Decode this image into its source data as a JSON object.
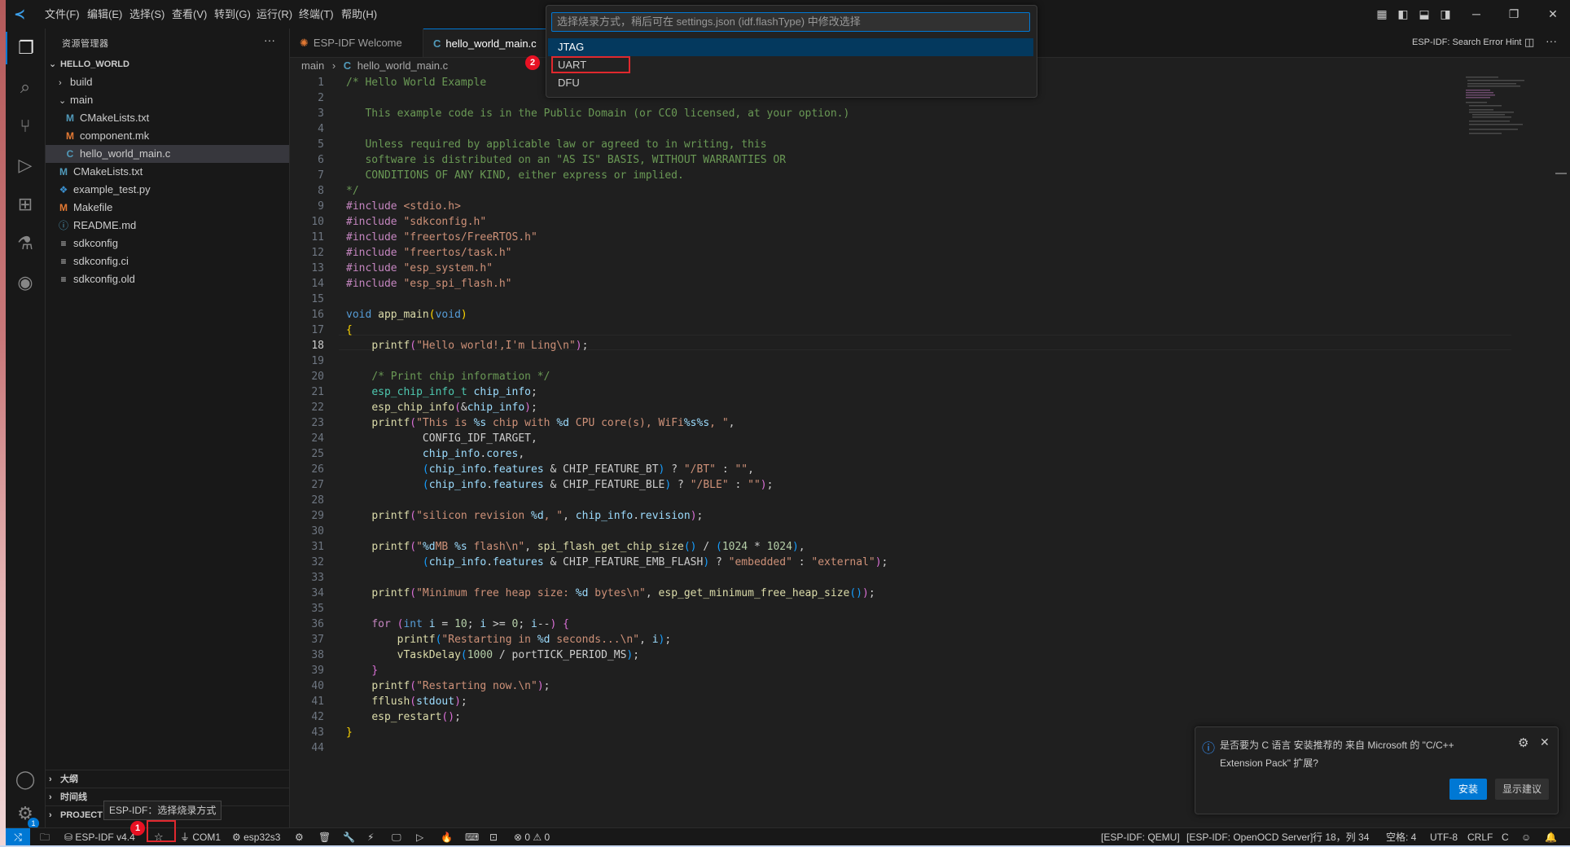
{
  "titlebar": {
    "menus": [
      "文件(F)",
      "编辑(E)",
      "选择(S)",
      "查看(V)",
      "转到(G)",
      "运行(R)",
      "终端(T)",
      "帮助(H)"
    ],
    "controls": {
      "minimize": "─",
      "restore": "❐",
      "close": "✕"
    }
  },
  "activitybar": {
    "icons": [
      "files-icon",
      "search-icon",
      "source-control-icon",
      "run-debug-icon",
      "extensions-icon",
      "testing-icon",
      "esp-idf-icon"
    ],
    "accounts_icon": "account-icon",
    "settings_icon": "gear-icon",
    "settings_badge": "1"
  },
  "sidebar": {
    "title": "资源管理器",
    "more": "···",
    "root": "HELLO_WORLD",
    "items": [
      {
        "label": "build",
        "type": "folder"
      },
      {
        "label": "main",
        "type": "folder-open"
      },
      {
        "label": "CMakeLists.txt",
        "type": "cmake"
      },
      {
        "label": "component.mk",
        "type": "make"
      },
      {
        "label": "hello_world_main.c",
        "type": "c"
      },
      {
        "label": "CMakeLists.txt",
        "type": "cmake"
      },
      {
        "label": "example_test.py",
        "type": "py"
      },
      {
        "label": "Makefile",
        "type": "make"
      },
      {
        "label": "README.md",
        "type": "info"
      },
      {
        "label": "sdkconfig",
        "type": "text"
      },
      {
        "label": "sdkconfig.ci",
        "type": "text"
      },
      {
        "label": "sdkconfig.old",
        "type": "text"
      }
    ],
    "sections": [
      "大纲",
      "时间线",
      "PROJECT"
    ]
  },
  "tabs": [
    {
      "label": "ESP-IDF Welcome",
      "icon": "esp-idf-icon"
    },
    {
      "label": "hello_world_main.c",
      "icon": "c-file-icon"
    }
  ],
  "editor_actions": {
    "hint": "ESP-IDF: Search Error Hint"
  },
  "breadcrumb": {
    "folder": "main",
    "file": "hello_world_main.c"
  },
  "editor": {
    "active_line": 18,
    "line_count": 44
  },
  "quickpick": {
    "placeholder": "选择烧录方式，稍后可在 settings.json (idf.flashType) 中修改选择",
    "items": [
      "JTAG",
      "UART",
      "DFU"
    ],
    "active_index": 0
  },
  "annotations": {
    "badge1": "1",
    "badge2": "2"
  },
  "tooltip": "ESP-IDF：选择烧录方式",
  "notification": {
    "message_line1": "是否要为 C 语言 安装推荐的 来自 Microsoft 的 \"C/C++",
    "message_line2": "Extension Pack\" 扩展?",
    "install": "安装",
    "show_recommendations": "显示建议"
  },
  "statusbar": {
    "remote": "⤭",
    "idf_version": "ESP-IDF v4.4",
    "port": "COM1",
    "target": "esp32s3",
    "problems": "⊗ 0 ⚠ 0",
    "qemu": "[ESP-IDF: QEMU]",
    "openocd": "[ESP-IDF: OpenOCD Server]",
    "position": "行 18，列 34",
    "spaces": "空格: 4",
    "encoding": "UTF-8",
    "eol": "CRLF",
    "language": "C"
  },
  "colors": {
    "accent": "#0078d4",
    "highlight": "#e0282e",
    "background": "#1f1f1f"
  }
}
